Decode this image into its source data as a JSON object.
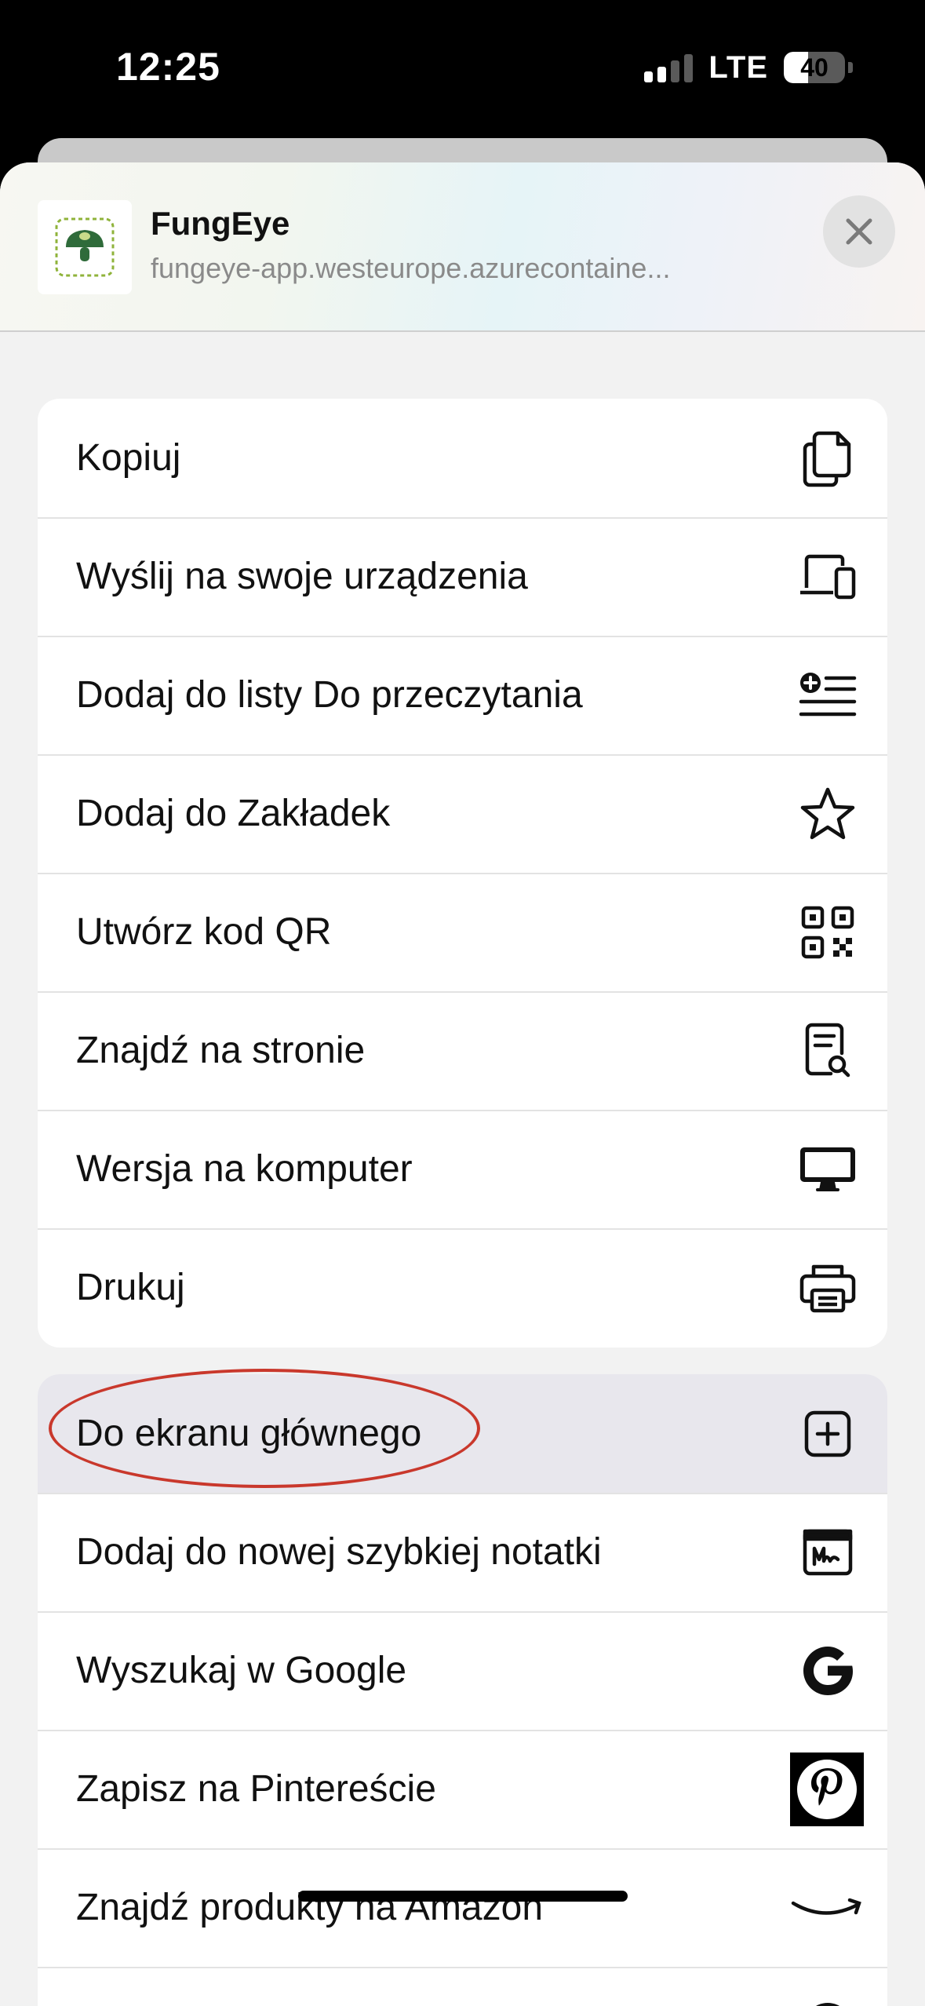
{
  "status_bar": {
    "time": "12:25",
    "network": "LTE",
    "battery_percent": "40",
    "battery_level": 0.4,
    "signal_bars_active": 2
  },
  "header": {
    "app_name": "FungEye",
    "url": "fungeye-app.westeurope.azurecontaine..."
  },
  "menu_group_1": [
    {
      "label": "Kopiuj",
      "icon": "copy-icon"
    },
    {
      "label": "Wyślij na swoje urządzenia",
      "icon": "devices-icon"
    },
    {
      "label": "Dodaj do listy Do przeczytania",
      "icon": "reading-list-add-icon"
    },
    {
      "label": "Dodaj do Zakładek",
      "icon": "star-icon"
    },
    {
      "label": "Utwórz kod QR",
      "icon": "qr-code-icon"
    },
    {
      "label": "Znajdź na stronie",
      "icon": "find-on-page-icon"
    },
    {
      "label": "Wersja na komputer",
      "icon": "desktop-icon"
    },
    {
      "label": "Drukuj",
      "icon": "printer-icon"
    }
  ],
  "menu_group_2": [
    {
      "label": "Do ekranu głównego",
      "icon": "add-square-icon",
      "highlighted": true
    },
    {
      "label": "Dodaj do nowej szybkiej notatki",
      "icon": "quick-note-icon"
    },
    {
      "label": "Wyszukaj w Google",
      "icon": "google-icon"
    },
    {
      "label": "Zapisz na Pintereście",
      "icon": "pinterest-icon"
    },
    {
      "label": "Znajdź produkty na Amazon",
      "icon": "amazon-icon"
    },
    {
      "label": "",
      "icon": "more-icon"
    }
  ],
  "colors": {
    "highlight_row": "#e8e7ed",
    "annotation": "#c9382c",
    "app_icon_green": "#2f6b3a"
  }
}
